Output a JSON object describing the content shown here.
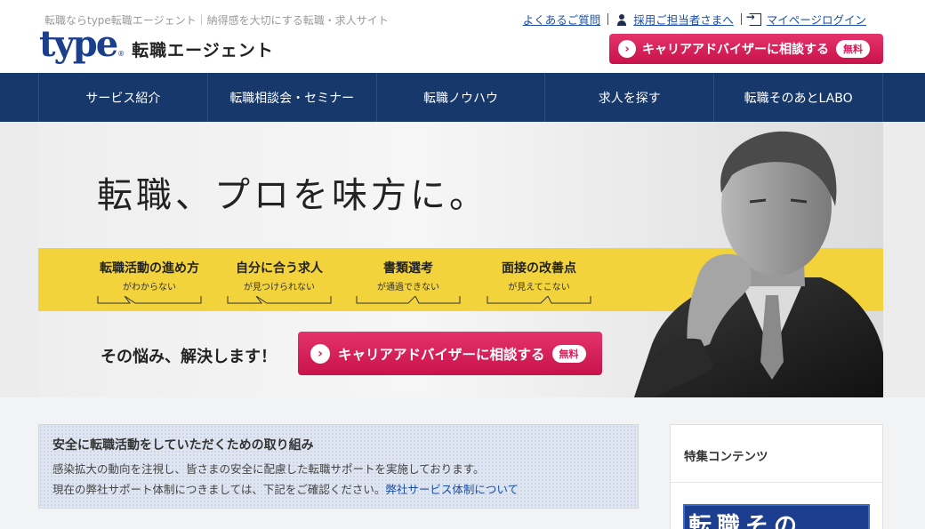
{
  "header": {
    "tagline": "転職ならtype転職エージェント｜納得感を大切にする転職・求人サイト",
    "logo_type": "type",
    "logo_reg": "®",
    "logo_sub": "転職エージェント",
    "links": {
      "faq": "よくあるご質問",
      "recruiter": "採用ご担当者さまへ",
      "mypage": "マイページログイン"
    },
    "cta_label": "キャリアアドバイザーに相談する",
    "cta_badge": "無料"
  },
  "nav": {
    "items": [
      "サービス紹介",
      "転職相談会・セミナー",
      "転職ノウハウ",
      "求人を探す",
      "転職そのあとLABO"
    ]
  },
  "hero": {
    "title": "転職、プロを味方に。",
    "worries": [
      {
        "main": "転職活動の進め方",
        "sub": "がわからない"
      },
      {
        "main": "自分に合う求人",
        "sub": "が見つけられない"
      },
      {
        "main": "書類選考",
        "sub": "が通過できない"
      },
      {
        "main": "面接の改善点",
        "sub": "が見えてこない"
      }
    ],
    "solve": "その悩み、解決します！",
    "cta_label": "キャリアアドバイザーに相談する",
    "cta_badge": "無料"
  },
  "notice": {
    "title": "安全に転職活動をしていただくための取り組み",
    "line1": "感染拡大の動向を注視し、皆さまの安全に配慮した転職サポートを実施しております。",
    "line2": "現在の弊社サポート体制につきましては、下記をご確認ください。",
    "link": "弊社サービス体制について"
  },
  "sidebar": {
    "title": "特集コンテンツ",
    "banner_text": "転職その"
  },
  "colors": {
    "brand_blue": "#1b3f8b",
    "nav_bg": "#17386a",
    "cta_pink": "#d51d59",
    "band_yellow": "#f3d33c",
    "link_blue": "#1b4fa5"
  },
  "icons": {
    "cta_arrow": "chevron-right-circle-icon",
    "recruiter": "person-icon",
    "mypage": "login-icon"
  }
}
